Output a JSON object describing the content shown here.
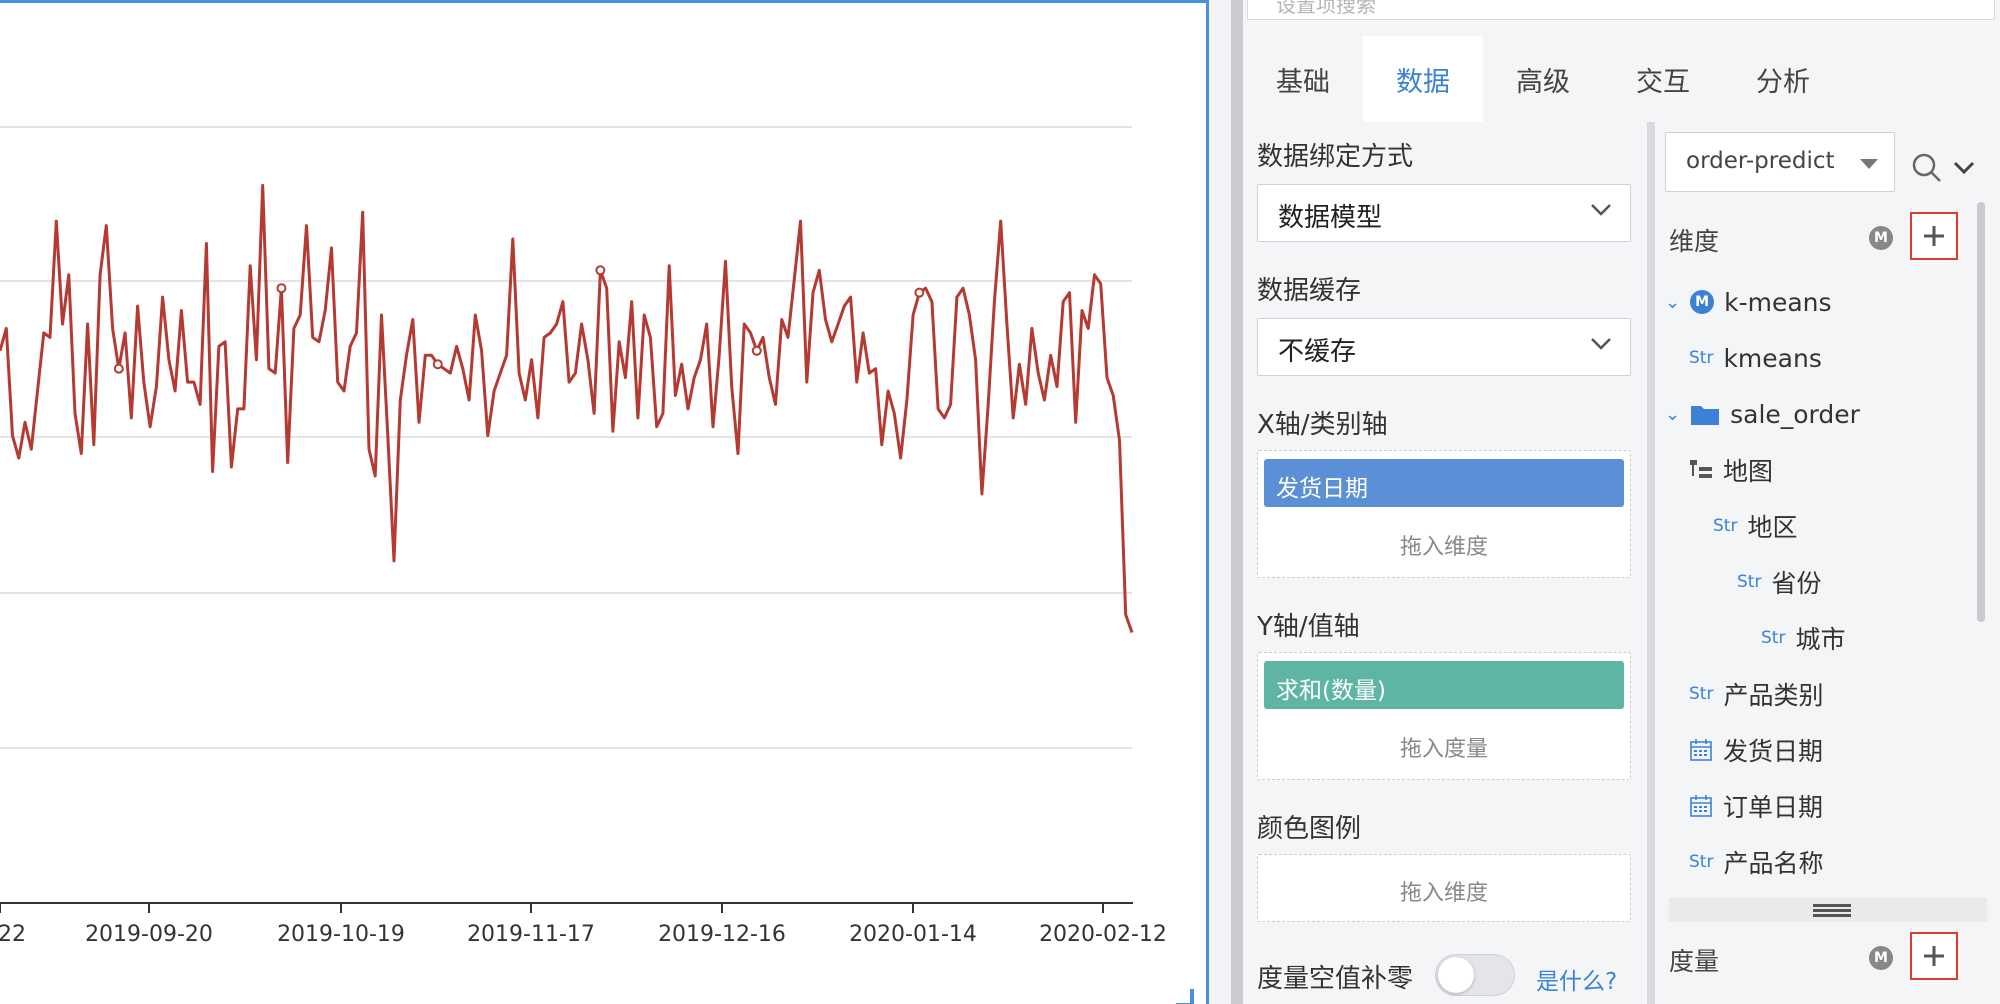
{
  "chart_data": {
    "type": "line",
    "title": "",
    "xlabel": "",
    "ylabel": "",
    "x_ticks": [
      "22",
      "2019-09-20",
      "2019-10-19",
      "2019-11-17",
      "2019-12-16",
      "2020-01-14",
      "2020-02-12"
    ],
    "grid": true,
    "series": [
      {
        "color": "#b53a32",
        "values": [
          0.62,
          0.67,
          0.43,
          0.38,
          0.46,
          0.4,
          0.53,
          0.66,
          0.65,
          0.91,
          0.68,
          0.79,
          0.48,
          0.39,
          0.68,
          0.41,
          0.79,
          0.9,
          0.67,
          0.58,
          0.66,
          0.47,
          0.72,
          0.55,
          0.45,
          0.54,
          0.74,
          0.6,
          0.53,
          0.71,
          0.55,
          0.55,
          0.5,
          0.86,
          0.35,
          0.63,
          0.64,
          0.36,
          0.49,
          0.49,
          0.81,
          0.6,
          0.99,
          0.58,
          0.57,
          0.76,
          0.37,
          0.67,
          0.7,
          0.9,
          0.65,
          0.64,
          0.71,
          0.85,
          0.55,
          0.53,
          0.63,
          0.66,
          0.93,
          0.4,
          0.34,
          0.7,
          0.43,
          0.15,
          0.51,
          0.61,
          0.69,
          0.46,
          0.61,
          0.61,
          0.59,
          0.58,
          0.57,
          0.63,
          0.58,
          0.51,
          0.7,
          0.62,
          0.43,
          0.53,
          0.57,
          0.61,
          0.87,
          0.57,
          0.51,
          0.6,
          0.47,
          0.65,
          0.66,
          0.68,
          0.73,
          0.55,
          0.57,
          0.68,
          0.6,
          0.48,
          0.8,
          0.76,
          0.44,
          0.64,
          0.56,
          0.73,
          0.47,
          0.7,
          0.65,
          0.45,
          0.48,
          0.81,
          0.52,
          0.59,
          0.49,
          0.56,
          0.6,
          0.68,
          0.45,
          0.61,
          0.82,
          0.54,
          0.39,
          0.68,
          0.66,
          0.62,
          0.65,
          0.56,
          0.5,
          0.69,
          0.65,
          0.78,
          0.91,
          0.55,
          0.75,
          0.8,
          0.69,
          0.64,
          0.68,
          0.72,
          0.74,
          0.55,
          0.66,
          0.57,
          0.58,
          0.41,
          0.53,
          0.48,
          0.38,
          0.51,
          0.7,
          0.75,
          0.76,
          0.73,
          0.49,
          0.47,
          0.5,
          0.74,
          0.76,
          0.7,
          0.6,
          0.3,
          0.5,
          0.73,
          0.91,
          0.68,
          0.47,
          0.59,
          0.5,
          0.67,
          0.57,
          0.51,
          0.61,
          0.54,
          0.73,
          0.75,
          0.46,
          0.71,
          0.67,
          0.79,
          0.77,
          0.56,
          0.52,
          0.42,
          0.03,
          -0.01
        ]
      }
    ]
  },
  "search": {
    "placeholder": "设置项搜索"
  },
  "tabs": [
    {
      "label": "基础",
      "active": false
    },
    {
      "label": "数据",
      "active": true
    },
    {
      "label": "高级",
      "active": false
    },
    {
      "label": "交互",
      "active": false
    },
    {
      "label": "分析",
      "active": false
    }
  ],
  "binding": {
    "label": "数据绑定方式",
    "value": "数据模型"
  },
  "cache": {
    "label": "数据缓存",
    "value": "不缓存"
  },
  "x_axis": {
    "label": "X轴/类别轴",
    "pill": "发货日期",
    "pill_color": "#5b8fd6",
    "hint": "拖入维度"
  },
  "y_axis": {
    "label": "Y轴/值轴",
    "pill": "求和(数量)",
    "pill_color": "#5fb5a3",
    "hint": "拖入度量"
  },
  "legend": {
    "label": "颜色图例",
    "hint": "拖入维度"
  },
  "null_fill": {
    "label": "度量空值补零",
    "on": false,
    "link": "是什么?"
  },
  "datasource": {
    "value": "order-predict"
  },
  "dimensions": {
    "title": "维度",
    "tree": [
      {
        "label": "k-means",
        "kind": "model"
      },
      {
        "label": "kmeans",
        "kind": "str"
      },
      {
        "label": "sale_order",
        "kind": "folder"
      },
      {
        "label": "地图",
        "kind": "hierarchy"
      },
      {
        "label": "地区",
        "kind": "str"
      },
      {
        "label": "省份",
        "kind": "str"
      },
      {
        "label": "城市",
        "kind": "str"
      },
      {
        "label": "产品类别",
        "kind": "str"
      },
      {
        "label": "发货日期",
        "kind": "date"
      },
      {
        "label": "订单日期",
        "kind": "date"
      },
      {
        "label": "产品名称",
        "kind": "str"
      }
    ],
    "str_tag": "Str"
  },
  "measures": {
    "title": "度量"
  }
}
